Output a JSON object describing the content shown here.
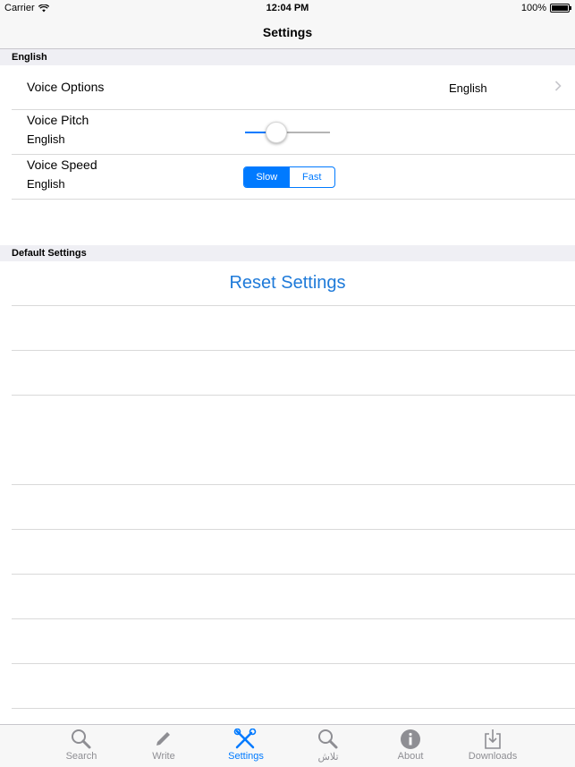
{
  "status": {
    "carrier": "Carrier",
    "time": "12:04 PM",
    "battery": "100%"
  },
  "nav": {
    "title": "Settings"
  },
  "sections": {
    "english": {
      "header": "English",
      "voice_options": {
        "label": "Voice Options",
        "value": "English"
      },
      "voice_pitch": {
        "label": "Voice Pitch",
        "subtitle": "English",
        "level": 0.37
      },
      "voice_speed": {
        "label": "Voice Speed",
        "subtitle": "English",
        "options": [
          "Slow",
          "Fast"
        ],
        "selected": "Slow"
      }
    },
    "defaults": {
      "header": "Default Settings",
      "reset_label": "Reset Settings"
    }
  },
  "colors": {
    "accent": "#007aff",
    "reset_text": "#1e7ad9"
  },
  "tabs": [
    {
      "label": "Search",
      "icon": "search-icon",
      "active": false
    },
    {
      "label": "Write",
      "icon": "pencil-icon",
      "active": false
    },
    {
      "label": "Settings",
      "icon": "tools-icon",
      "active": true
    },
    {
      "label": "تلاش",
      "icon": "search-icon",
      "active": false
    },
    {
      "label": "About",
      "icon": "info-icon",
      "active": false
    },
    {
      "label": "Downloads",
      "icon": "download-icon",
      "active": false
    }
  ]
}
